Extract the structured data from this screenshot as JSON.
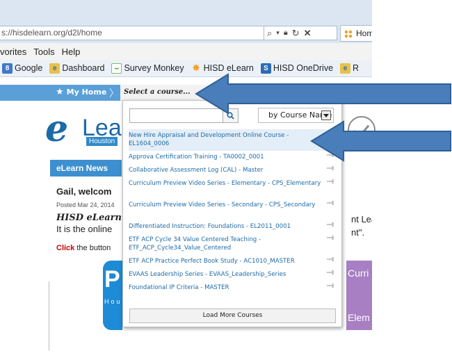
{
  "browser": {
    "address": "s://hisdelearn.org/d2l/home",
    "tab_title": "Hom",
    "menu": [
      "vorites",
      "Tools",
      "Help"
    ],
    "favorites": [
      {
        "label": "Google",
        "icon": "google-icon"
      },
      {
        "label": "Dashboard",
        "icon": "ie-page-icon"
      },
      {
        "label": "Survey Monkey",
        "icon": "survey-monkey-icon"
      },
      {
        "label": "HISD eLearn",
        "icon": "elearn-icon"
      },
      {
        "label": "HISD OneDrive",
        "icon": "onedrive-icon"
      },
      {
        "label": "R",
        "icon": "ie-page-icon"
      }
    ]
  },
  "nav": {
    "home": "My Home",
    "select_course": "Select a course..."
  },
  "page": {
    "logo_e": "e",
    "logo_text": "Lea",
    "logo_sub": "Houston",
    "news_header": "eLearn News",
    "welcome": "Gail, welcom",
    "posted": "Posted Mar 24, 2014",
    "hisd_line": "HISD eLearn",
    "online_line": "It is the online",
    "click_word": "Click",
    "click_rest": " the button",
    "right_frag1": "nt Lea",
    "right_frag2": "nt\".",
    "tile_left": "P",
    "tile_left_sub": "Hou",
    "tile_right_top": "Curri",
    "tile_right_bottom": "Elem"
  },
  "dropdown": {
    "search_placeholder": "",
    "sort_value": "by Course Name",
    "courses": [
      "New Hire Appraisal and Development Online Course - EL1604_0006",
      "Approva Certification Training - TA0002_0001",
      "Collaborative Assessment Log (CAL) - Master",
      "Curriculum Preview Video Series - Elementary - CPS_Elementary",
      "Curriculum Preview Video Series - Secondary - CPS_Secondary",
      "Differentiated Instruction: Foundations - EL2011_0001",
      "ETF ACP Cycle 34 Value Centered Teaching - ETF_ACP_Cycle34_Value_Centered",
      "ETF ACP Practice Perfect Book Study - AC1010_MASTER",
      "EVAAS Leadership Series - EVAAS_Leadership_Series",
      "Foundational IP Criteria - MASTER"
    ],
    "load_more": "Load More Courses"
  },
  "colors": {
    "arrow": "#4a7ebb",
    "link": "#1d6aa6",
    "nav_blue": "#5a9fd8"
  }
}
